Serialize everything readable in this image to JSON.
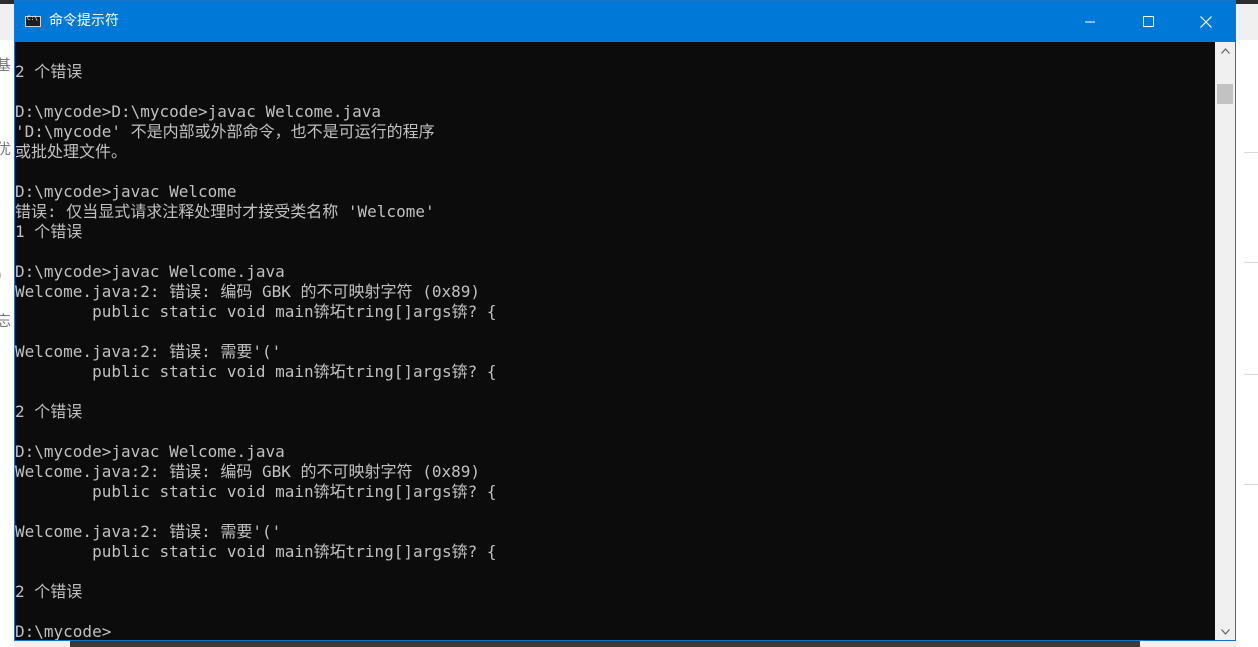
{
  "window": {
    "title": "命令提示符",
    "icon": "cmd-icon",
    "controls": {
      "minimize_icon": "minimize-icon",
      "maximize_icon": "maximize-icon",
      "close_icon": "close-icon"
    },
    "colors": {
      "titlebar": "#0078d7",
      "console_bg": "#0c0c0c",
      "console_fg": "#c0c0c0"
    }
  },
  "console": {
    "lines": [
      "",
      "2 个错误",
      "",
      "D:\\mycode>D:\\mycode>javac Welcome.java",
      "'D:\\mycode' 不是内部或外部命令，也不是可运行的程序",
      "或批处理文件。",
      "",
      "D:\\mycode>javac Welcome",
      "错误: 仅当显式请求注释处理时才接受类名称 'Welcome'",
      "1 个错误",
      "",
      "D:\\mycode>javac Welcome.java",
      "Welcome.java:2: 错误: 编码 GBK 的不可映射字符 (0x89)",
      "        public static void main锛坧tring[]args锛? {",
      "",
      "Welcome.java:2: 错误: 需要'('",
      "        public static void main锛坧tring[]args锛? {",
      "",
      "2 个错误",
      "",
      "D:\\mycode>javac Welcome.java",
      "Welcome.java:2: 错误: 编码 GBK 的不可映射字符 (0x89)",
      "        public static void main锛坧tring[]args锛? {",
      "",
      "Welcome.java:2: 错误: 需要'('",
      "        public static void main锛坧tring[]args锛? {",
      "",
      "2 个错误",
      "",
      "D:\\mycode>"
    ]
  },
  "scrollbar": {
    "up_icon": "scroll-up-arrow-icon",
    "down_icon": "scroll-down-arrow-icon"
  }
}
